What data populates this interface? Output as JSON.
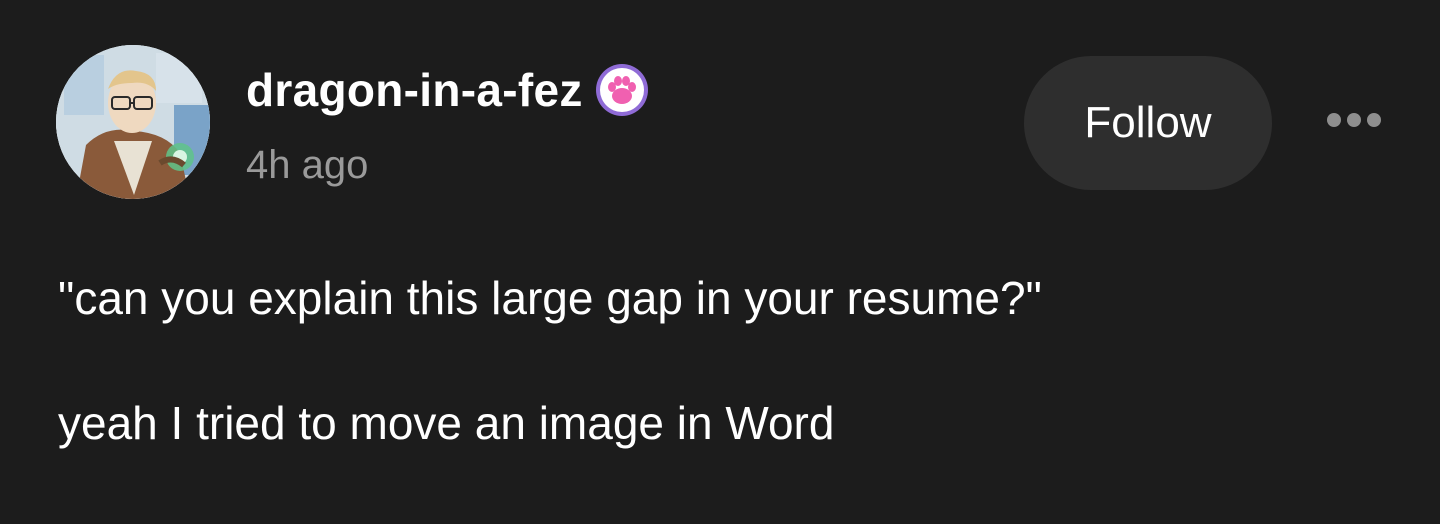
{
  "post": {
    "author": {
      "username": "dragon-in-a-fez",
      "avatar_icon": "avatar-illustration",
      "badge_icon": "paw-print-badge-icon"
    },
    "timestamp": "4h ago",
    "follow_label": "Follow",
    "more_icon": "ellipsis-icon",
    "body": {
      "paragraphs": [
        "\"can you explain this large gap in your resume?\"",
        "yeah I tried to move an image in Word"
      ]
    }
  },
  "colors": {
    "background": "#1c1c1c",
    "button_bg": "#2e2e2e",
    "text": "#ffffff",
    "muted_text": "#9a9a9a",
    "badge_purple": "#8f6bd6",
    "badge_pink": "#f060b0"
  }
}
